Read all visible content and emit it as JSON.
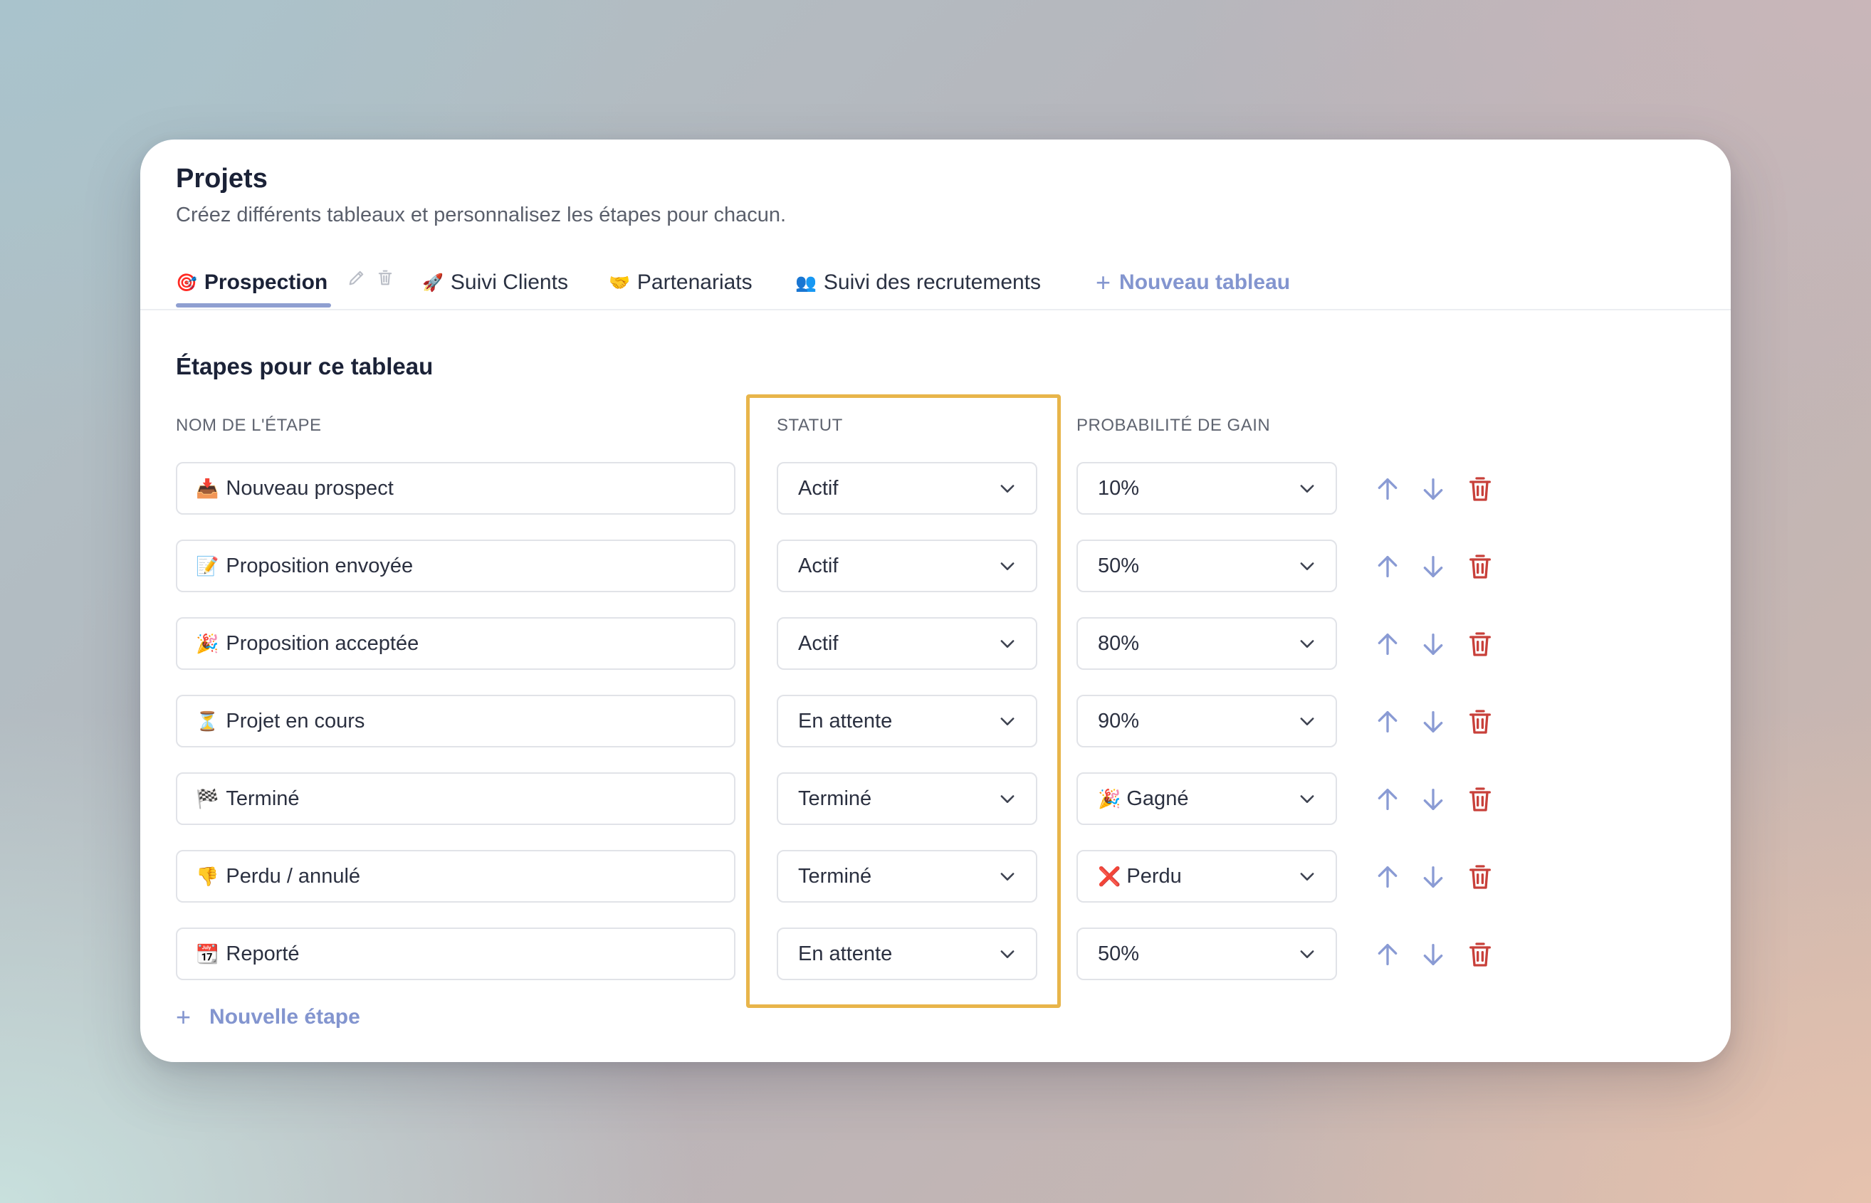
{
  "header": {
    "title": "Projets",
    "subtitle": "Créez différents tableaux et personnalisez les étapes pour chacun."
  },
  "tabs": [
    {
      "emoji": "🎯",
      "label": "Prospection",
      "active": true
    },
    {
      "emoji": "🚀",
      "label": "Suivi Clients"
    },
    {
      "emoji": "🤝",
      "label": "Partenariats"
    },
    {
      "emoji": "👥",
      "label": "Suivi des recrutements"
    }
  ],
  "new_tab_label": "Nouveau tableau",
  "section_title": "Étapes pour ce tableau",
  "columns": {
    "name": "NOM DE L'ÉTAPE",
    "status": "STATUT",
    "probability": "PROBABILITÉ DE GAIN"
  },
  "stages": [
    {
      "emoji": "📥",
      "name": "Nouveau prospect",
      "status": "Actif",
      "prob_emoji": "",
      "probability": "10%"
    },
    {
      "emoji": "📝",
      "name": "Proposition envoyée",
      "status": "Actif",
      "prob_emoji": "",
      "probability": "50%"
    },
    {
      "emoji": "🎉",
      "name": "Proposition acceptée",
      "status": "Actif",
      "prob_emoji": "",
      "probability": "80%"
    },
    {
      "emoji": "⏳",
      "name": "Projet en cours",
      "status": "En attente",
      "prob_emoji": "",
      "probability": "90%"
    },
    {
      "emoji": "🏁",
      "name": "Terminé",
      "status": "Terminé",
      "prob_emoji": "🎉",
      "probability": "Gagné"
    },
    {
      "emoji": "👎",
      "name": "Perdu / annulé",
      "status": "Terminé",
      "prob_emoji": "❌",
      "probability": "Perdu"
    },
    {
      "emoji": "📆",
      "name": "Reporté",
      "status": "En attente",
      "prob_emoji": "",
      "probability": "50%"
    }
  ],
  "new_stage_label": "Nouvelle étape",
  "colors": {
    "accent": "#8395cf",
    "delete": "#c8403a",
    "highlight": "#e8b54a"
  }
}
